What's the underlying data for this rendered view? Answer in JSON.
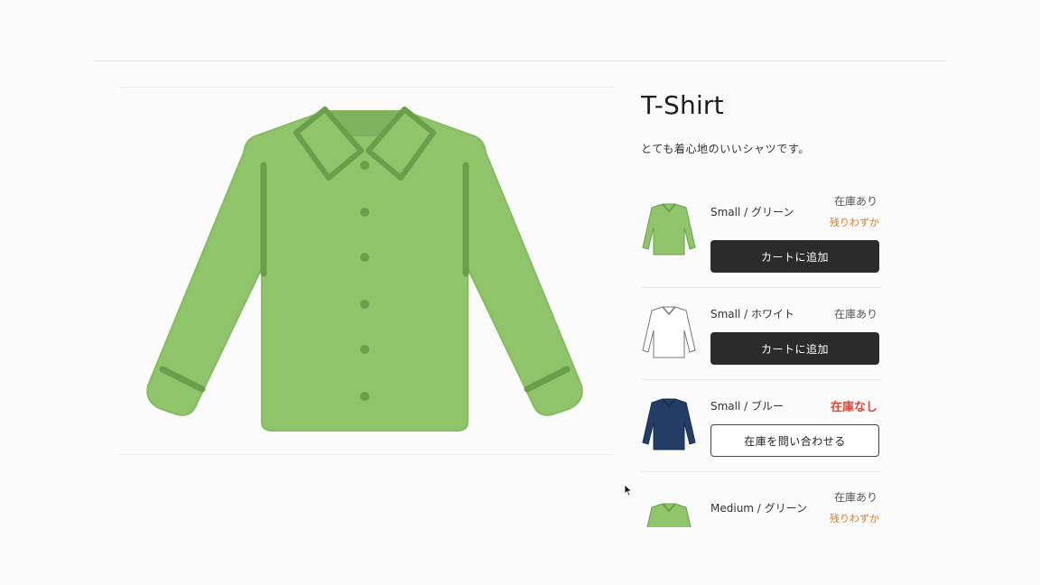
{
  "product": {
    "title": "T-Shirt",
    "description": "とても着心地のいいシャツです。"
  },
  "variants": [
    {
      "name": "Small / グリーン",
      "stock": "在庫あり",
      "note": "残りわずか",
      "button": "カートに追加",
      "color": "#8fc46b"
    },
    {
      "name": "Small / ホワイト",
      "stock": "在庫あり",
      "button": "カートに追加",
      "color": "#ffffff"
    },
    {
      "name": "Small / ブルー",
      "stock": "在庫なし",
      "button": "在庫を問い合わせる",
      "color": "#233d66"
    },
    {
      "name": "Medium / グリーン",
      "stock": "在庫あり",
      "note": "残りわずか",
      "color": "#8fc46b"
    }
  ],
  "colors": {
    "low_stock": "#e07b2a",
    "out_of_stock": "#e0453a",
    "button_dark": "#2b2b2b"
  }
}
